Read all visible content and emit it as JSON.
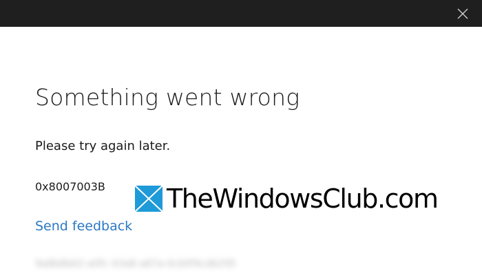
{
  "window": {
    "close_icon": "close-icon"
  },
  "dialog": {
    "title": "Something went wrong",
    "message": "Please try again later.",
    "error_code": "0x8007003B",
    "feedback_link": "Send feedback",
    "correlation_id": "9a8b8b62-a0fc-43a8-a87a-0cb0f4cdb295"
  },
  "watermark": {
    "text": "TheWindowsClub.com",
    "logo_icon": "windows-logo-icon",
    "accent": "#1e9ad9"
  }
}
